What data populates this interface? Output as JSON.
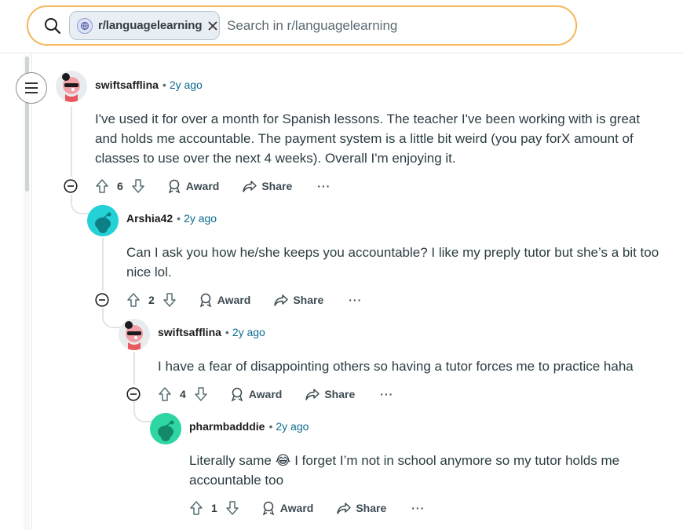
{
  "search": {
    "community_chip": "r/languagelearning",
    "placeholder": "Search in r/languagelearning"
  },
  "comments": [
    {
      "author": "swiftsafflina",
      "time": "2y ago",
      "body": "I've used it for over a month for Spanish lessons. The teacher I've been working with is great and holds me accountable. The payment system is a little bit weird (you pay forX amount of classes to use over the next 4 weeks). Overall I'm enjoying it.",
      "score": "6",
      "award_label": "Award",
      "share_label": "Share",
      "more_label": "···"
    },
    {
      "author": "Arshia42",
      "time": "2y ago",
      "body": "Can I ask you how he/she keeps you accountable? I like my preply tutor but she’s a bit too nice lol.",
      "score": "2",
      "award_label": "Award",
      "share_label": "Share",
      "more_label": "···"
    },
    {
      "author": "swiftsafflina",
      "time": "2y ago",
      "body": "I have a fear of disappointing others so having a tutor forces me to practice haha",
      "score": "4",
      "award_label": "Award",
      "share_label": "Share",
      "more_label": "···"
    },
    {
      "author": "pharmbadddie",
      "time": "2y ago",
      "body_line1": "Literally same",
      "emoji": "😂",
      "body_line1_rest": "I forget I’m not in school anymore so my tutor holds me",
      "body_line2": "accountable too",
      "score": "1",
      "award_label": "Award",
      "share_label": "Share",
      "more_label": "···"
    }
  ],
  "separator": "•",
  "colors": {
    "accent_time": "#0b6b8e",
    "search_border": "#f2a73b",
    "avatar_teal": "#24d1d6",
    "avatar_mint": "#2ed6a4"
  }
}
